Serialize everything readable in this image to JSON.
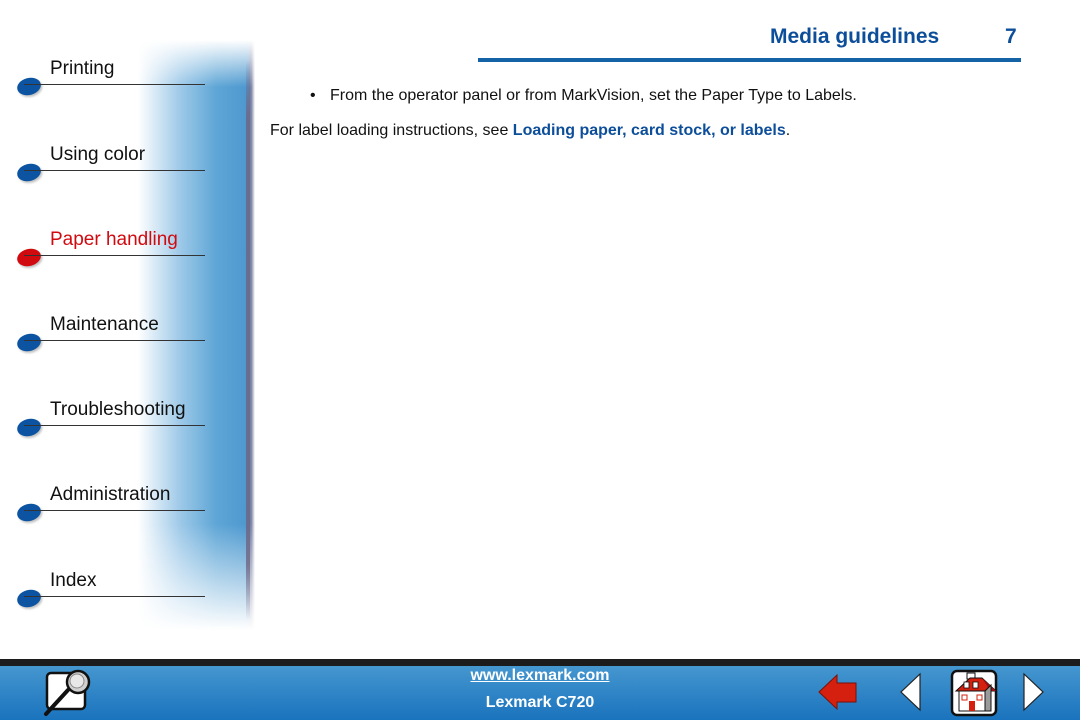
{
  "header": {
    "title": "Media guidelines",
    "page_number": "7",
    "accent_color": "#0d4e9a"
  },
  "sidebar": {
    "items": [
      {
        "label": "Printing",
        "active": false
      },
      {
        "label": "Using color",
        "active": false
      },
      {
        "label": "Paper handling",
        "active": true
      },
      {
        "label": "Maintenance",
        "active": false
      },
      {
        "label": "Troubleshooting",
        "active": false
      },
      {
        "label": "Administration",
        "active": false
      },
      {
        "label": "Index",
        "active": false
      }
    ],
    "active_color": "#d10a10",
    "bullet_color": "#0c54a2"
  },
  "content": {
    "bullet": "•",
    "bullet_text": "From the operator panel or from MarkVision, set the Paper Type to Labels.",
    "para_prefix": "For label loading instructions, see ",
    "para_link": "Loading paper, card stock, or labels",
    "para_suffix": "."
  },
  "footer": {
    "url": "www.lexmark.com",
    "model": "Lexmark C720",
    "icons": [
      "search-icon",
      "back-arrow-icon",
      "previous-page-icon",
      "home-icon",
      "next-page-icon"
    ]
  }
}
